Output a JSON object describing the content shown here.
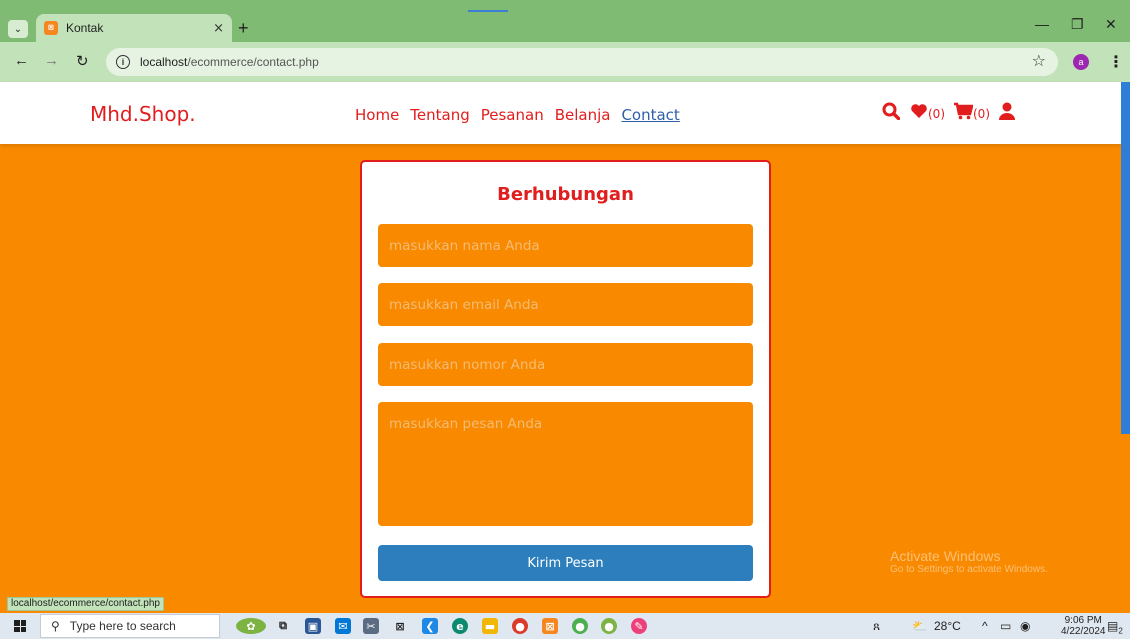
{
  "browser": {
    "tab_title": "Kontak",
    "tab_close": "×",
    "new_tab": "+",
    "url_host": "localhost",
    "url_path": "/ecommerce/contact.php",
    "status_url": "localhost/ecommerce/contact.php",
    "profile_initial": "a"
  },
  "site": {
    "logo": "Mhd.Shop.",
    "nav": [
      "Home",
      "Tentang",
      "Pesanan",
      "Belanja",
      "Contact"
    ],
    "active_nav": "Contact",
    "wishlist_count": "(0)",
    "cart_count": "(0)"
  },
  "form": {
    "title": "Berhubungan",
    "name_placeholder": "masukkan nama Anda",
    "email_placeholder": "masukkan email Anda",
    "number_placeholder": "masukkan nomor Anda",
    "message_placeholder": "masukkan pesan Anda",
    "submit_label": "Kirim Pesan"
  },
  "watermark": {
    "title": "Activate Windows",
    "subtitle": "Go to Settings to activate Windows."
  },
  "taskbar": {
    "search_placeholder": "Type here to search",
    "temperature": "28°C",
    "time": "9:06 PM",
    "date": "4/22/2024",
    "notification_count": "2"
  },
  "colors": {
    "page_bg": "#f98a00",
    "accent_red": "#e11d1d",
    "submit_blue": "#2c7ebc",
    "active_link": "#2f5fa8",
    "tab_green": "#80bb74"
  }
}
